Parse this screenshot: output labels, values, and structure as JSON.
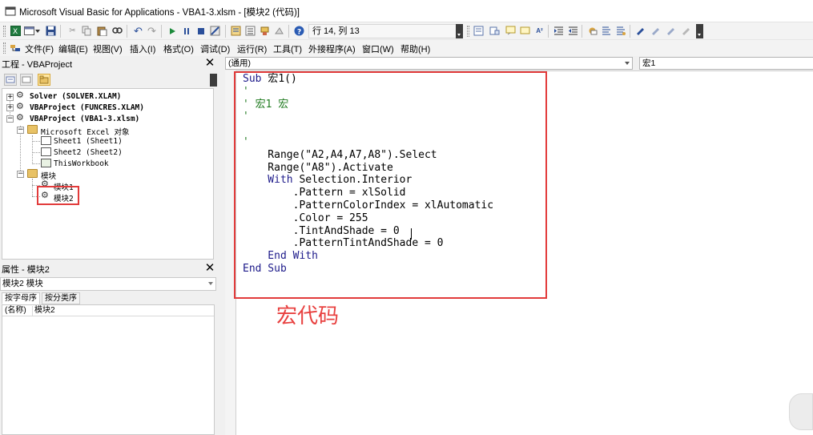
{
  "window": {
    "title": "Microsoft Visual Basic for Applications - VBA1-3.xlsm - [模块2 (代码)]",
    "app_icon": "vba-app-icon"
  },
  "toolbar": {
    "position_text": "行 14, 列 13",
    "icons": [
      "excel-icon",
      "insert-userform-icon",
      "save-icon",
      "cut-icon",
      "copy-icon",
      "paste-icon",
      "find-icon",
      "undo-icon",
      "redo-icon",
      "run-icon",
      "break-icon",
      "reset-icon",
      "design-mode-icon",
      "project-explorer-icon",
      "properties-window-icon",
      "object-browser-icon",
      "toolbox-icon",
      "help-icon"
    ],
    "icons2": [
      "list-properties-icon",
      "list-constants-icon",
      "quick-info-icon",
      "parameter-info-icon",
      "complete-word-icon",
      "indent-icon",
      "outdent-icon",
      "toggle-breakpoint-icon",
      "comment-block-icon",
      "uncomment-block-icon",
      "toggle-bookmark-icon",
      "next-bookmark-icon",
      "prev-bookmark-icon",
      "clear-bookmarks-icon"
    ]
  },
  "menu": {
    "items": [
      "文件(F)",
      "编辑(E)",
      "视图(V)",
      "插入(I)",
      "格式(O)",
      "调试(D)",
      "运行(R)",
      "工具(T)",
      "外接程序(A)",
      "窗口(W)",
      "帮助(H)"
    ]
  },
  "project": {
    "title": "工程 - VBAProject",
    "close": "✕",
    "tree": {
      "solver": "Solver (SOLVER.XLAM)",
      "funcres": "VBAProject (FUNCRES.XLAM)",
      "vba13": "VBAProject (VBA1-3.xlsm)",
      "excel_objects": "Microsoft Excel 对象",
      "sheet1": "Sheet1 (Sheet1)",
      "sheet2": "Sheet2 (Sheet2)",
      "thisworkbook": "ThisWorkbook",
      "modules": "模块",
      "module1": "模块1",
      "module2": "模块2"
    }
  },
  "properties": {
    "title": "属性 - 模块2",
    "close": "✕",
    "object_select": "模块2 模块",
    "tabs": [
      "按字母序",
      "按分类序"
    ],
    "rows": [
      {
        "key": "(名称)",
        "value": "模块2"
      }
    ]
  },
  "code": {
    "object_combo": "(通用)",
    "proc_combo": "宏1",
    "lines": [
      {
        "kw": "Sub ",
        "text": "宏1()",
        "cls": ""
      },
      {
        "kw": "",
        "text": "'",
        "cls": "cm"
      },
      {
        "kw": "",
        "text": "' 宏1 宏",
        "cls": "cm"
      },
      {
        "kw": "",
        "text": "'",
        "cls": "cm"
      },
      {
        "kw": "",
        "text": "",
        "cls": ""
      },
      {
        "kw": "",
        "text": "'",
        "cls": "cm"
      },
      {
        "kw": "",
        "text": "    Range(\"A2,A4,A7,A8\").Select",
        "cls": ""
      },
      {
        "kw": "",
        "text": "    Range(\"A8\").Activate",
        "cls": ""
      },
      {
        "kw": "    With ",
        "text": "Selection.Interior",
        "cls": ""
      },
      {
        "kw": "",
        "text": "        .Pattern = xlSolid",
        "cls": ""
      },
      {
        "kw": "",
        "text": "        .PatternColorIndex = xlAutomatic",
        "cls": ""
      },
      {
        "kw": "",
        "text": "        .Color = 255",
        "cls": ""
      },
      {
        "kw": "",
        "text": "        .TintAndShade = 0",
        "cls": ""
      },
      {
        "kw": "",
        "text": "        .PatternTintAndShade = 0",
        "cls": ""
      },
      {
        "kw": "    End With",
        "text": "",
        "cls": ""
      },
      {
        "kw": "End Sub",
        "text": "",
        "cls": ""
      }
    ],
    "caption": "宏代码"
  },
  "colors": {
    "highlight": "#e23b3b",
    "keyword": "#1d1a8a",
    "comment": "#1f7a1f"
  }
}
